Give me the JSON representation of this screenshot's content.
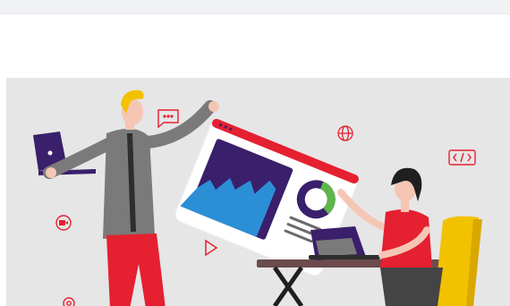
{
  "page": {
    "top_bar": "",
    "hero": {
      "illustration": "web-analytics-teamwork-illustration",
      "icons": [
        "chat-bubble-icon",
        "globe-icon",
        "code-brackets-icon",
        "video-camera-icon",
        "play-icon",
        "gear-icon"
      ],
      "colors": {
        "background": "#e6e6e6",
        "accent_red": "#e52030",
        "accent_purple": "#3a1f6b",
        "accent_yellow": "#f2c200",
        "donut_green": "#5fb54a"
      }
    }
  }
}
